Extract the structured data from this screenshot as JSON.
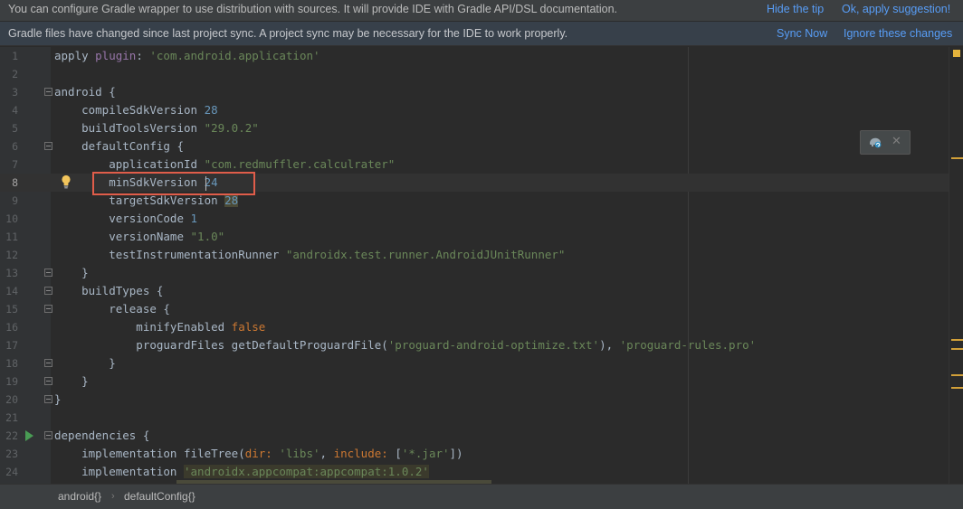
{
  "tip_banner": {
    "message": "You can configure Gradle wrapper to use distribution with sources. It will provide IDE with Gradle API/DSL documentation.",
    "hide_label": "Hide the tip",
    "apply_label": "Ok, apply suggestion!"
  },
  "sync_banner": {
    "message": "Gradle files have changed since last project sync. A project sync may be necessary for the IDE to work properly.",
    "sync_label": "Sync Now",
    "ignore_label": "Ignore these changes"
  },
  "editor": {
    "current_line": 8,
    "lines": [
      {
        "n": "1"
      },
      {
        "n": "2"
      },
      {
        "n": "3"
      },
      {
        "n": "4"
      },
      {
        "n": "5"
      },
      {
        "n": "6"
      },
      {
        "n": "7"
      },
      {
        "n": "8"
      },
      {
        "n": "9"
      },
      {
        "n": "10"
      },
      {
        "n": "11"
      },
      {
        "n": "12"
      },
      {
        "n": "13"
      },
      {
        "n": "14"
      },
      {
        "n": "15"
      },
      {
        "n": "16"
      },
      {
        "n": "17"
      },
      {
        "n": "18"
      },
      {
        "n": "19"
      },
      {
        "n": "20"
      },
      {
        "n": "21"
      },
      {
        "n": "22"
      },
      {
        "n": "23"
      },
      {
        "n": "24"
      }
    ],
    "code": {
      "l1_a": "apply ",
      "l1_b": "plugin",
      "l1_c": ": ",
      "l1_d": "'com.android.application'",
      "l3": "android {",
      "l4_a": "    compileSdkVersion ",
      "l4_b": "28",
      "l5_a": "    buildToolsVersion ",
      "l5_b": "\"29.0.2\"",
      "l6": "    defaultConfig {",
      "l7_a": "        applicationId ",
      "l7_b": "\"com.redmuffler.calculrater\"",
      "l8_a": "        minSdkVersion ",
      "l8_b": "24",
      "l9_a": "        targetSdkVersion ",
      "l9_b": "28",
      "l10_a": "        versionCode ",
      "l10_b": "1",
      "l11_a": "        versionName ",
      "l11_b": "\"1.0\"",
      "l12_a": "        testInstrumentationRunner ",
      "l12_b": "\"androidx.test.runner.AndroidJUnitRunner\"",
      "l13": "    }",
      "l14": "    buildTypes {",
      "l15": "        release {",
      "l16_a": "            minifyEnabled ",
      "l16_b": "false",
      "l17_a": "            proguardFiles getDefaultProguardFile(",
      "l17_b": "'proguard-android-optimize.txt'",
      "l17_c": "), ",
      "l17_d": "'proguard-rules.pro'",
      "l18": "        }",
      "l19": "    }",
      "l20": "}",
      "l22": "dependencies {",
      "l23_a": "    implementation fileTree(",
      "l23_b": "dir: ",
      "l23_c": "'libs'",
      "l23_d": ", ",
      "l23_e": "include: ",
      "l23_f": "[",
      "l23_g": "'*.jar'",
      "l23_h": "])",
      "l24_a": "    implementation ",
      "l24_b": "'androidx.appcompat:appcompat:1.0.2'"
    }
  },
  "breadcrumbs": [
    "android{}",
    "defaultConfig{}"
  ],
  "colors": {
    "accent_link": "#589df6",
    "highlight_box": "#e05d4a",
    "string": "#6a8759",
    "number": "#6897bb",
    "keyword": "#cc7832"
  }
}
